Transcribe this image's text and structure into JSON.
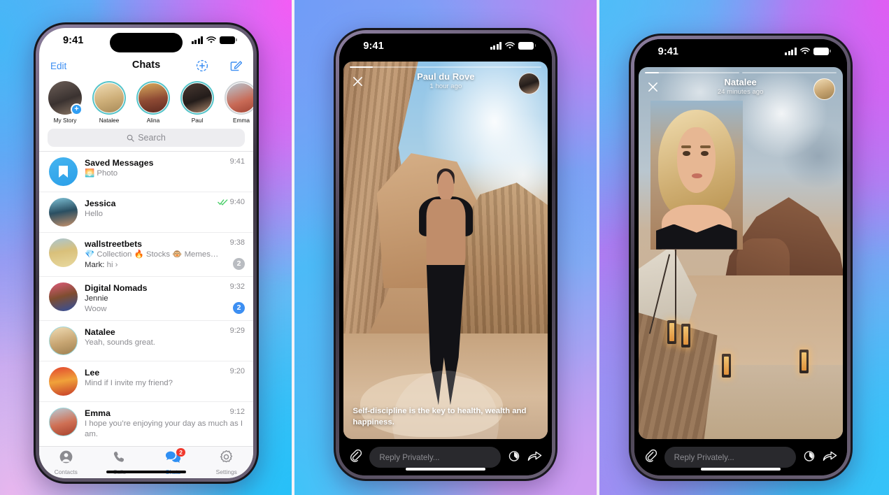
{
  "colors": {
    "ios_blue": "#3d8ff2",
    "telegram_blue": "#2f8ff3",
    "badge_red": "#f0392d",
    "badge_grey": "#b9bcc1",
    "check_green": "#4bcf6a",
    "story_ring": "#55c4c9",
    "story_ring_seen": "#cfd3d6"
  },
  "panels": [
    {
      "id": "chat-list",
      "status_bar": {
        "time": "9:41",
        "icons": [
          "cellular-signal-icon",
          "wifi-icon",
          "battery-icon"
        ]
      },
      "navbar": {
        "edit_label": "Edit",
        "title": "Chats",
        "story_button_icon": "add-story-icon",
        "compose_button_icon": "compose-icon"
      },
      "stories": [
        {
          "name": "My Story",
          "state": "mine",
          "badge_icon": "plus-icon"
        },
        {
          "name": "Natalee",
          "state": "unseen"
        },
        {
          "name": "Alina",
          "state": "unseen"
        },
        {
          "name": "Paul",
          "state": "unseen"
        },
        {
          "name": "Emma",
          "state": "seen"
        }
      ],
      "search": {
        "placeholder": "Search",
        "icon": "search-icon"
      },
      "chats": [
        {
          "name": "Saved Messages",
          "avatar": "bookmark-icon",
          "preview": "Photo",
          "preview_emoji": "🌅",
          "time": "9:41"
        },
        {
          "name": "Jessica",
          "preview": "Hello",
          "time": "9:40",
          "read_status": "double-check-read"
        },
        {
          "name": "wallstreetbets",
          "preview": "💎 Collection 🔥 Stocks 🐵 Memes…",
          "sender_line": "Mark:",
          "sender_message": "hi ›",
          "time": "9:38",
          "badge": "2",
          "badge_style": "muted"
        },
        {
          "name": "Digital Nomads",
          "sender_line": "Jennie",
          "preview": "Woow",
          "time": "9:32",
          "badge": "2",
          "badge_style": "unread"
        },
        {
          "name": "Natalee",
          "preview": "Yeah, sounds great.",
          "time": "9:29",
          "has_story_ring": true
        },
        {
          "name": "Lee",
          "preview": "Mind if I invite my friend?",
          "time": "9:20"
        },
        {
          "name": "Emma",
          "preview": "I hope you’re enjoying your day as much as I am.",
          "time": "9:12",
          "has_story_ring": true
        }
      ],
      "tabs": [
        {
          "label": "Contacts",
          "icon": "contacts-icon",
          "active": false
        },
        {
          "label": "Calls",
          "icon": "phone-icon",
          "active": false
        },
        {
          "label": "Chats",
          "icon": "chats-icon",
          "active": true,
          "count": "2"
        },
        {
          "label": "Settings",
          "icon": "gear-icon",
          "active": false
        }
      ]
    },
    {
      "id": "story-viewer-paul",
      "status_bar": {
        "time": "9:41",
        "icons": [
          "cellular-signal-icon",
          "wifi-icon",
          "battery-icon"
        ]
      },
      "story": {
        "author": "Paul du Rove",
        "timestamp": "1 hour ago",
        "close_icon": "close-icon",
        "avatar": "author-avatar",
        "progress_segments": [
          12
        ],
        "caption": "Self-discipline is the key to health, wealth and happiness."
      },
      "reply_bar": {
        "attach_icon": "paperclip-icon",
        "placeholder": "Reply Privately...",
        "timer_icon": "stopwatch-icon",
        "share_icon": "forward-arrow-icon"
      }
    },
    {
      "id": "story-viewer-natalee",
      "status_bar": {
        "time": "9:41",
        "icons": [
          "cellular-signal-icon",
          "wifi-icon",
          "battery-icon"
        ]
      },
      "story": {
        "author": "Natalee",
        "timestamp": "24 minutes ago",
        "close_icon": "close-icon",
        "avatar": "author-avatar",
        "progress_segments": [
          15,
          0
        ],
        "caption": ""
      },
      "reply_bar": {
        "attach_icon": "paperclip-icon",
        "placeholder": "Reply Privately...",
        "timer_icon": "stopwatch-icon",
        "share_icon": "forward-arrow-icon"
      }
    }
  ]
}
